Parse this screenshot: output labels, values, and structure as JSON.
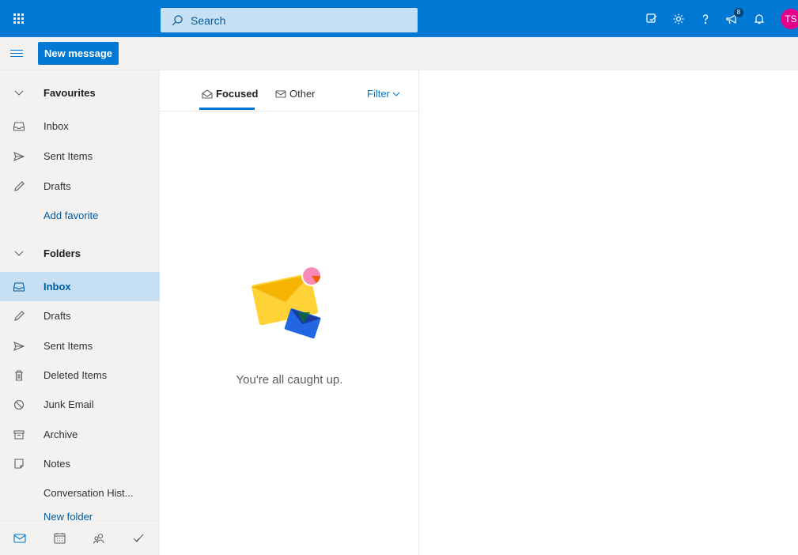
{
  "topbar": {
    "search_placeholder": "Search",
    "notification_count": "8",
    "avatar_initials": "TS"
  },
  "cmdbar": {
    "new_message_label": "New message"
  },
  "nav": {
    "favourites_label": "Favourites",
    "favourites": [
      {
        "label": "Inbox",
        "icon": "inbox-icon"
      },
      {
        "label": "Sent Items",
        "icon": "send-icon"
      },
      {
        "label": "Drafts",
        "icon": "pencil-icon"
      }
    ],
    "add_favorite_label": "Add favorite",
    "folders_label": "Folders",
    "folders": [
      {
        "label": "Inbox",
        "icon": "inbox-icon"
      },
      {
        "label": "Drafts",
        "icon": "pencil-icon"
      },
      {
        "label": "Sent Items",
        "icon": "send-icon"
      },
      {
        "label": "Deleted Items",
        "icon": "trash-icon"
      },
      {
        "label": "Junk Email",
        "icon": "block-icon"
      },
      {
        "label": "Archive",
        "icon": "archive-icon"
      },
      {
        "label": "Notes",
        "icon": "note-icon"
      },
      {
        "label": "Conversation Hist...",
        "icon": ""
      }
    ],
    "new_folder_label": "New folder"
  },
  "list": {
    "tab_focused": "Focused",
    "tab_other": "Other",
    "filter_label": "Filter",
    "empty_message": "You're all caught up."
  },
  "colors": {
    "brand": "#0078d4",
    "selected_bg": "#c7e0f4",
    "avatar": "#e3008c"
  }
}
